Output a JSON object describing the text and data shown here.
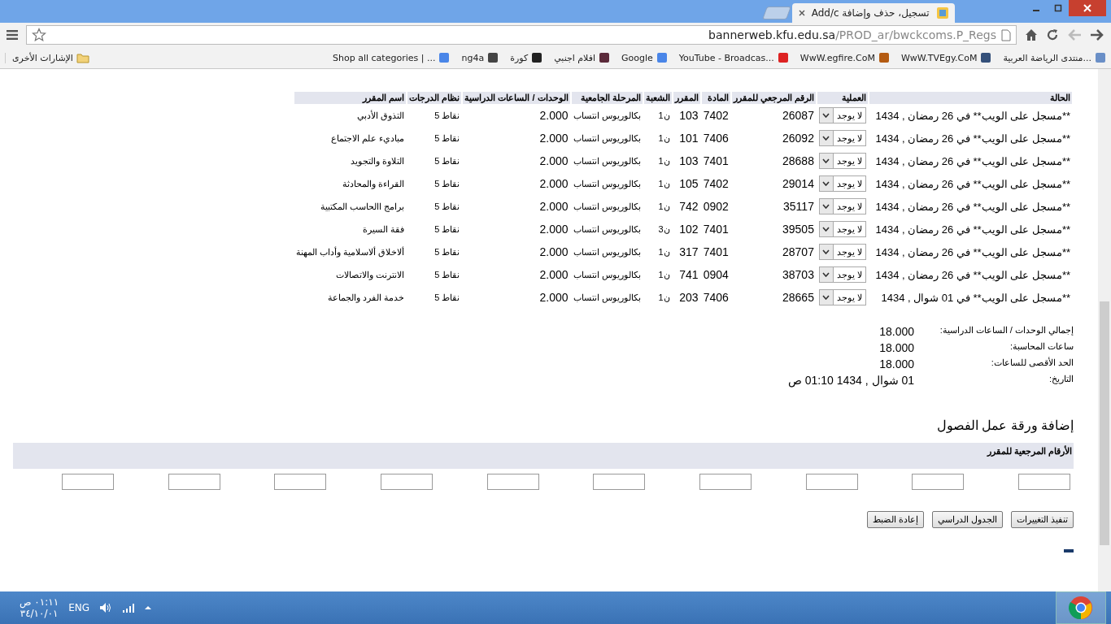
{
  "browser": {
    "tab_title": "تسجيل، حذف وإضافة Add/c",
    "address": {
      "host": "bannerweb.kfu.edu.sa",
      "path": "/PROD_ar/bwckcoms.P_Regs"
    },
    "bookmarks": [
      {
        "label": "منتدى الرياضة العربية..."
      },
      {
        "label": "WwW.TVEgy.CoM"
      },
      {
        "label": "WwW.egfire.CoM"
      },
      {
        "label": "YouTube - Broadcas..."
      },
      {
        "label": "Google"
      },
      {
        "label": "افلام اجنبي"
      },
      {
        "label": "كورة"
      },
      {
        "label": "ng4a"
      },
      {
        "label": "Shop all categories | ..."
      }
    ],
    "other_bookmarks": "الإشارات الأخرى"
  },
  "schedule": {
    "columns": [
      "الحالة",
      "العملية",
      "الرقم المرجعي للمقرر",
      "المادة",
      "المقرر",
      "الشعبة",
      "المرحلة الجامعية",
      "الوحدات / الساعات الدراسية",
      "نظام الدرجات",
      "اسم المقرر"
    ],
    "rows": [
      {
        "status": "**مسجل على الويب** في 26 رمضان , 1434",
        "action": "لا يوجد",
        "crn": "26087",
        "subject": "7402",
        "course": "103",
        "section": "ن1",
        "level": "بكالوريوس انتساب",
        "units": "2.000",
        "grading": "نقاط 5",
        "title": "التذوق الأدبي"
      },
      {
        "status": "**مسجل على الويب** في 26 رمضان , 1434",
        "action": "لا يوجد",
        "crn": "26092",
        "subject": "7406",
        "course": "101",
        "section": "ن1",
        "level": "بكالوريوس انتساب",
        "units": "2.000",
        "grading": "نقاط 5",
        "title": "مباديء علم الاجتماع"
      },
      {
        "status": "**مسجل على الويب** في 26 رمضان , 1434",
        "action": "لا يوجد",
        "crn": "28688",
        "subject": "7401",
        "course": "103",
        "section": "ن1",
        "level": "بكالوريوس انتساب",
        "units": "2.000",
        "grading": "نقاط 5",
        "title": "التلاوة والتجويد"
      },
      {
        "status": "**مسجل على الويب** في 26 رمضان , 1434",
        "action": "لا يوجد",
        "crn": "29014",
        "subject": "7402",
        "course": "105",
        "section": "ن1",
        "level": "بكالوريوس انتساب",
        "units": "2.000",
        "grading": "نقاط 5",
        "title": "القراءة والمحادثة"
      },
      {
        "status": "**مسجل على الويب** في 26 رمضان , 1434",
        "action": "لا يوجد",
        "crn": "35117",
        "subject": "0902",
        "course": "742",
        "section": "ن1",
        "level": "بكالوريوس انتساب",
        "units": "2.000",
        "grading": "نقاط 5",
        "title": "برامج االحاسب المكتبية"
      },
      {
        "status": "**مسجل على الويب** في 26 رمضان , 1434",
        "action": "لا يوجد",
        "crn": "39505",
        "subject": "7401",
        "course": "102",
        "section": "ن3",
        "level": "بكالوريوس انتساب",
        "units": "2.000",
        "grading": "نقاط 5",
        "title": "فقة السيرة"
      },
      {
        "status": "**مسجل على الويب** في 26 رمضان , 1434",
        "action": "لا يوجد",
        "crn": "28707",
        "subject": "7401",
        "course": "317",
        "section": "ن1",
        "level": "بكالوريوس انتساب",
        "units": "2.000",
        "grading": "نقاط 5",
        "title": "ألاخلاق ألاسلامية وأداب المهنة"
      },
      {
        "status": "**مسجل على الويب** في 26 رمضان , 1434",
        "action": "لا يوجد",
        "crn": "38703",
        "subject": "0904",
        "course": "741",
        "section": "ن1",
        "level": "بكالوريوس انتساب",
        "units": "2.000",
        "grading": "نقاط 5",
        "title": "الانترنت والاتصالات"
      },
      {
        "status": "**مسجل على الويب** في 01 شوال , 1434",
        "action": "لا يوجد",
        "crn": "28665",
        "subject": "7406",
        "course": "203",
        "section": "ن1",
        "level": "بكالوريوس انتساب",
        "units": "2.000",
        "grading": "نقاط 5",
        "title": "خدمة الفرد والجماعة"
      }
    ]
  },
  "summary": [
    {
      "label": "إجمالي الوحدات / الساعات الدراسية:",
      "value": "18.000"
    },
    {
      "label": "ساعات المحاسبة:",
      "value": "18.000"
    },
    {
      "label": "الحد الأقصى للساعات:",
      "value": "18.000"
    },
    {
      "label": "التاريخ:",
      "value": "01 شوال , 1434 01:10 ص"
    }
  ],
  "add_worksheet": {
    "title": "إضافة ورقة عمل الفصول",
    "header": "الأرقام المرجعية للمقرر",
    "fields": [
      {
        "kind": "input"
      },
      {
        "kind": "input"
      },
      {
        "kind": "input"
      },
      {
        "kind": "input"
      },
      {
        "kind": "input"
      },
      {
        "kind": "input"
      },
      {
        "kind": "input"
      },
      {
        "kind": "input"
      },
      {
        "kind": "input"
      },
      {
        "kind": "input"
      }
    ]
  },
  "buttons": [
    "تنفيذ التغييرات",
    "الجدول الدراسي",
    "إعادة الضبط"
  ],
  "taskbar": {
    "time": "٠١:١١ ص",
    "date": "٣٤/١٠/٠١",
    "language": "ENG"
  }
}
